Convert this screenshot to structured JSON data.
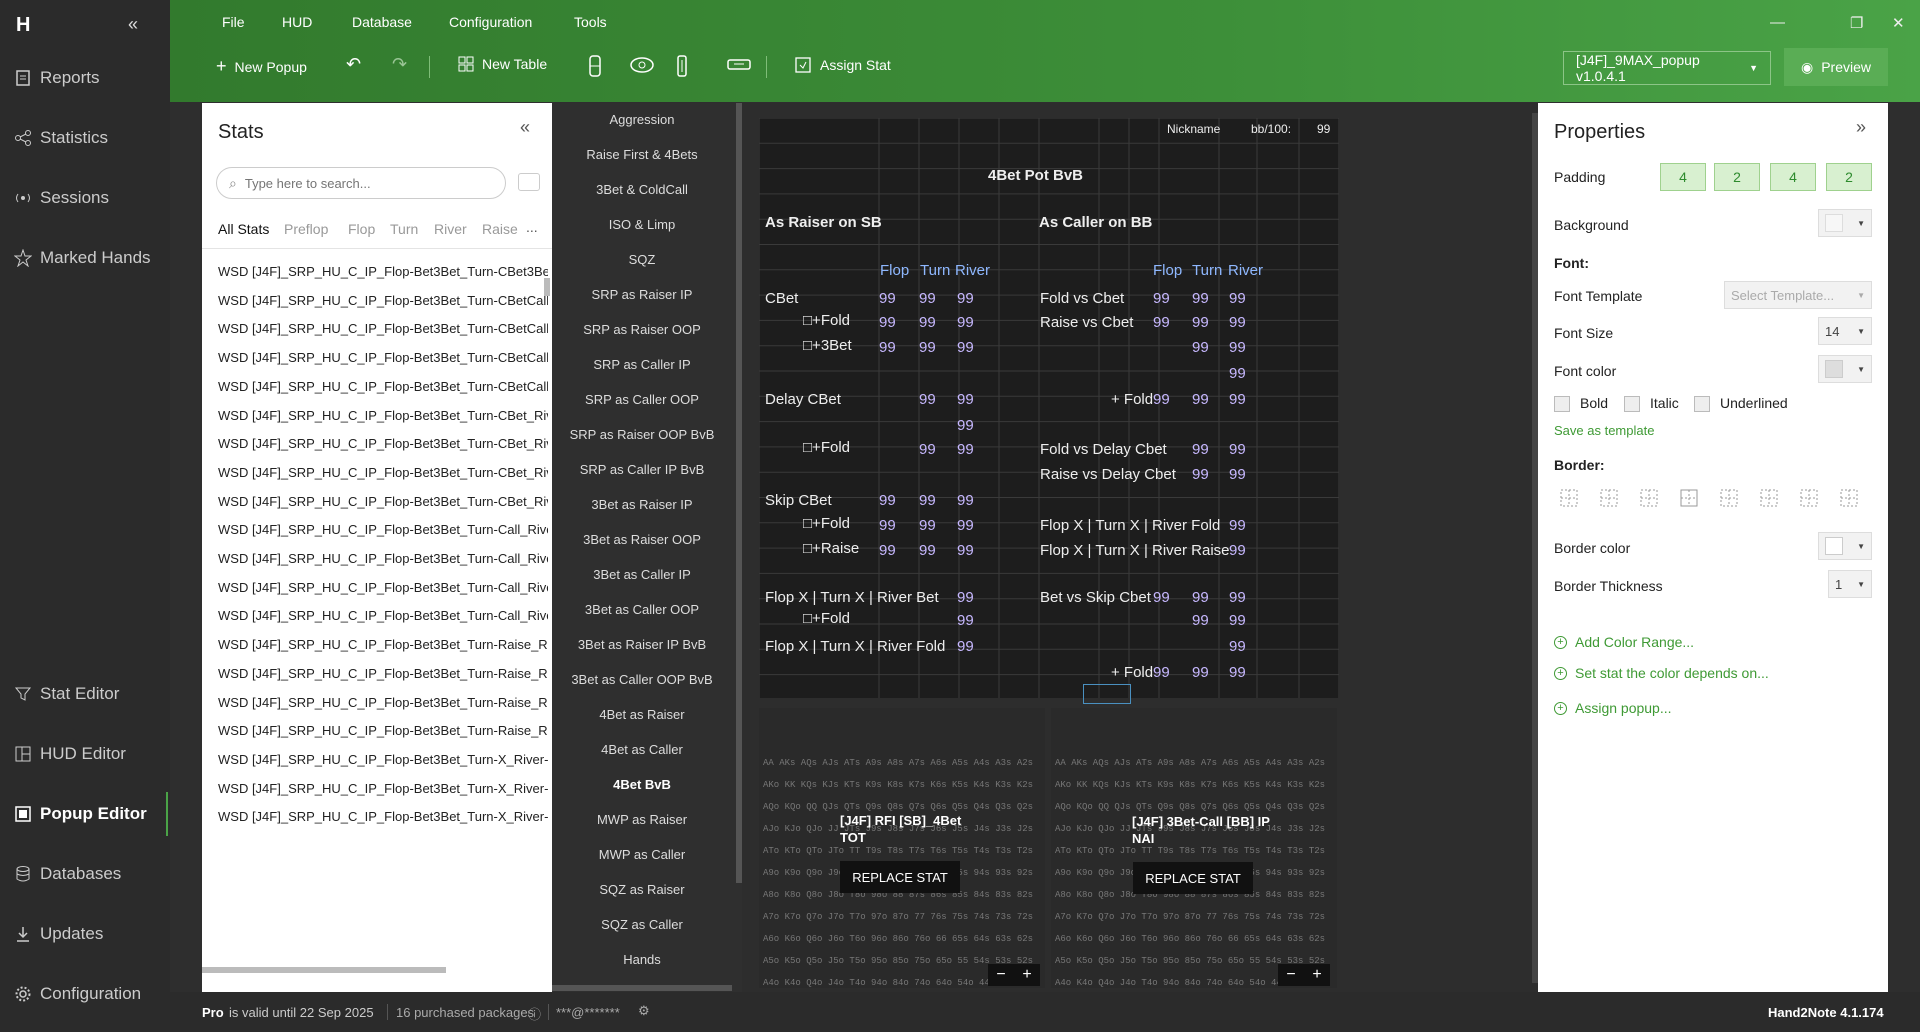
{
  "app": {
    "logo": "H"
  },
  "nav": {
    "items": [
      {
        "label": "Reports"
      },
      {
        "label": "Statistics"
      },
      {
        "label": "Sessions"
      },
      {
        "label": "Marked Hands"
      },
      {
        "label": "Stat Editor"
      },
      {
        "label": "HUD Editor"
      },
      {
        "label": "Popup Editor"
      },
      {
        "label": "Databases"
      },
      {
        "label": "Updates"
      },
      {
        "label": "Configuration"
      }
    ]
  },
  "menu": {
    "items": [
      "File",
      "HUD",
      "Database",
      "Configuration",
      "Tools"
    ]
  },
  "toolbar": {
    "new_popup": "New Popup",
    "new_table": "New Table",
    "assign_stat": "Assign Stat",
    "preset": "[J4F]_9MAX_popup v1.0.4.1",
    "preview": "Preview"
  },
  "stats": {
    "title": "Stats",
    "search_placeholder": "Type here to search...",
    "tabs": [
      "All Stats",
      "Preflop",
      "Flop",
      "Turn",
      "River",
      "Raise",
      "..."
    ],
    "rows": [
      "WSD [J4F]_SRP_HU_C_IP_Flop-Bet3Bet_Turn-CBet3Be",
      "WSD [J4F]_SRP_HU_C_IP_Flop-Bet3Bet_Turn-CBetCall_",
      "WSD [J4F]_SRP_HU_C_IP_Flop-Bet3Bet_Turn-CBetCall_",
      "WSD [J4F]_SRP_HU_C_IP_Flop-Bet3Bet_Turn-CBetCall_",
      "WSD [J4F]_SRP_HU_C_IP_Flop-Bet3Bet_Turn-CBetCall_",
      "WSD [J4F]_SRP_HU_C_IP_Flop-Bet3Bet_Turn-CBet_Riv",
      "WSD [J4F]_SRP_HU_C_IP_Flop-Bet3Bet_Turn-CBet_Riv",
      "WSD [J4F]_SRP_HU_C_IP_Flop-Bet3Bet_Turn-CBet_Riv",
      "WSD [J4F]_SRP_HU_C_IP_Flop-Bet3Bet_Turn-CBet_Riv",
      "WSD [J4F]_SRP_HU_C_IP_Flop-Bet3Bet_Turn-Call_Rive",
      "WSD [J4F]_SRP_HU_C_IP_Flop-Bet3Bet_Turn-Call_Rive",
      "WSD [J4F]_SRP_HU_C_IP_Flop-Bet3Bet_Turn-Call_Rive",
      "WSD [J4F]_SRP_HU_C_IP_Flop-Bet3Bet_Turn-Call_Rive",
      "WSD [J4F]_SRP_HU_C_IP_Flop-Bet3Bet_Turn-Raise_Riv",
      "WSD [J4F]_SRP_HU_C_IP_Flop-Bet3Bet_Turn-Raise_Riv",
      "WSD [J4F]_SRP_HU_C_IP_Flop-Bet3Bet_Turn-Raise_Riv",
      "WSD [J4F]_SRP_HU_C_IP_Flop-Bet3Bet_Turn-Raise_Riv",
      "WSD [J4F]_SRP_HU_C_IP_Flop-Bet3Bet_Turn-X_River-I",
      "WSD [J4F]_SRP_HU_C_IP_Flop-Bet3Bet_Turn-X_River-(",
      "WSD [J4F]_SRP_HU_C_IP_Flop-Bet3Bet_Turn-X_River-I"
    ]
  },
  "categories": [
    "Aggression",
    "Raise First & 4Bets",
    "3Bet & ColdCall",
    "ISO & Limp",
    "SQZ",
    "SRP as Raiser IP",
    "SRP as Raiser OOP",
    "SRP as Caller IP",
    "SRP as Caller OOP",
    "SRP as Raiser OOP BvB",
    "SRP as Caller IP BvB",
    "3Bet as Raiser IP",
    "3Bet as Raiser OOP",
    "3Bet as Caller IP",
    "3Bet as Caller OOP",
    "3Bet as Raiser IP BvB",
    "3Bet as Caller OOP BvB",
    "4Bet as Raiser",
    "4Bet as Caller",
    "4Bet BvB",
    "MWP as Raiser",
    "MWP as Caller",
    "SQZ as Raiser",
    "SQZ as Caller",
    "Hands"
  ],
  "active_category": "4Bet BvB",
  "popup": {
    "header": {
      "nickname": "Nickname",
      "bb": "bb/100:",
      "bb_value": "99"
    },
    "title": "4Bet Pot BvB",
    "left_section": "As Raiser on SB",
    "right_section": "As Caller on BB",
    "col_headers": [
      "Flop",
      "Turn",
      "River"
    ],
    "left_rows": [
      {
        "label": "CBet",
        "vals": [
          "99",
          "99",
          "99"
        ]
      },
      {
        "label": "□+Fold",
        "vals": [
          "99",
          "99",
          "99"
        ]
      },
      {
        "label": "□+3Bet",
        "vals": [
          "99",
          "99",
          "99"
        ]
      },
      {
        "label": "Delay CBet",
        "vals": [
          "",
          "99",
          "99"
        ]
      },
      {
        "label": "",
        "vals": [
          "",
          "",
          "99"
        ]
      },
      {
        "label": "□+Fold",
        "vals": [
          "",
          "99",
          "99"
        ]
      },
      {
        "label": "Skip CBet",
        "vals": [
          "99",
          "99",
          "99"
        ]
      },
      {
        "label": "□+Fold",
        "vals": [
          "99",
          "99",
          "99"
        ]
      },
      {
        "label": "□+Raise",
        "vals": [
          "99",
          "99",
          "99"
        ]
      },
      {
        "label": "Flop X | Turn X | River Bet",
        "vals": [
          "",
          "",
          "99"
        ]
      },
      {
        "label": "□+Fold",
        "vals": [
          "",
          "",
          "99"
        ]
      },
      {
        "label": "Flop X | Turn X | River Fold",
        "vals": [
          "",
          "",
          "99"
        ]
      }
    ],
    "right_rows": [
      {
        "label": "Fold vs Cbet",
        "vals": [
          "99",
          "99",
          "99"
        ]
      },
      {
        "label": "Raise vs Cbet",
        "vals": [
          "99",
          "99",
          "99"
        ]
      },
      {
        "label": "",
        "vals": [
          "",
          "99",
          "99"
        ]
      },
      {
        "label": "",
        "vals": [
          "",
          "",
          "99"
        ]
      },
      {
        "label": "+ Fold",
        "vals": [
          "99",
          "99",
          "99"
        ]
      },
      {
        "label": "Fold vs Delay Cbet",
        "vals": [
          "",
          "99",
          "99"
        ]
      },
      {
        "label": "Raise vs Delay Cbet",
        "vals": [
          "",
          "99",
          "99"
        ]
      },
      {
        "label": "Flop X | Turn X | River Fold",
        "vals": [
          "",
          "",
          "99"
        ]
      },
      {
        "label": "Flop X | Turn X | River Raise",
        "vals": [
          "",
          "",
          "99"
        ]
      },
      {
        "label": "Bet vs Skip Cbet",
        "vals": [
          "99",
          "99",
          "99"
        ]
      },
      {
        "label": "",
        "vals": [
          "",
          "99",
          "99"
        ]
      },
      {
        "label": "",
        "vals": [
          "",
          "",
          "99"
        ]
      },
      {
        "label": "+ Fold",
        "vals": [
          "99",
          "99",
          "99"
        ]
      }
    ],
    "range_left": {
      "label": "[J4F] RFI [SB]_4Bet TOT",
      "button": "REPLACE STAT"
    },
    "range_right": {
      "label": "[J4F] 3Bet-Call [BB] IP NAI",
      "button": "REPLACE STAT"
    },
    "range_rows": [
      "AA AKs AQs AJs ATs A9s A8s A7s A6s A5s A4s A3s A2s",
      "AKo KK KQs KJs KTs K9s K8s K7s K6s K5s K4s K3s K2s",
      "AQo KQo QQ QJs QTs Q9s Q8s Q7s Q6s Q5s Q4s Q3s Q2s",
      "AJo KJo QJo JJ JTs J9s J8s J7s J6s J5s J4s J3s J2s",
      "ATo KTo QTo JTo TT T9s T8s T7s T6s T5s T4s T3s T2s",
      "A9o K9o Q9o J9o T9o 99 98s 97s 96s 95s 94s 93s 92s",
      "A8o K8o Q8o J8o T8o 98o 88 87s 86s 85s 84s 83s 82s",
      "A7o K7o Q7o J7o T7o 97o 87o 77 76s 75s 74s 73s 72s",
      "A6o K6o Q6o J6o T6o 96o 86o 76o 66 65s 64s 63s 62s",
      "A5o K5o Q5o J5o T5o 95o 85o 75o 65o 55 54s 53s 52s",
      "A4o K4o Q4o J4o T4o 94o 84o 74o 64o 54o 44 43s 42s",
      "A3o K3o Q3o J3o T3o 93o 83o 73o 63o 53o 43o 33 32s",
      "A2o K2o Q2o J2o T2o 92o 82o 72o 62o 52o 42o 32o 22"
    ]
  },
  "properties": {
    "title": "Properties",
    "padding_label": "Padding",
    "padding": [
      "4",
      "2",
      "4",
      "2"
    ],
    "background_label": "Background",
    "font_heading": "Font:",
    "font_template_label": "Font Template",
    "font_template_placeholder": "Select Template...",
    "font_size_label": "Font Size",
    "font_size": "14",
    "font_color_label": "Font color",
    "bold": "Bold",
    "italic": "Italic",
    "underlined": "Underlined",
    "save_template": "Save as template",
    "border_heading": "Border:",
    "border_color_label": "Border color",
    "border_thickness_label": "Border Thickness",
    "border_thickness": "1",
    "links": [
      "Add Color Range...",
      "Set stat the color depends on...",
      "Assign popup..."
    ]
  },
  "status": {
    "plan": "Pro",
    "valid": "is valid until 22 Sep 2025",
    "packages": "16 purchased packages",
    "user": "***@*******",
    "version": "Hand2Note 4.1.174"
  },
  "colors": {
    "accent": "#3d8f39",
    "value": "#c7b8ff",
    "header_blue": "#8fb8ff"
  }
}
